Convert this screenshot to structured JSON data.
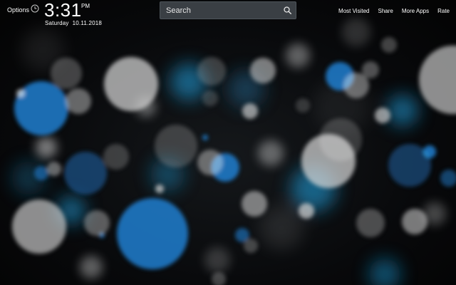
{
  "header": {
    "options_label": "Options",
    "clock_icon": "clock-icon",
    "time": "3:31",
    "ampm": "PM",
    "day": "Saturday",
    "date": "10.11.2018"
  },
  "search": {
    "placeholder": "Search",
    "icon": "search-icon"
  },
  "nav": {
    "most_visited": "Most Visited",
    "share": "Share",
    "more_apps": "More Apps",
    "rate": "Rate"
  },
  "wallpaper": {
    "theme": "blue and grey bokeh circles on black",
    "colors": {
      "background": "#050607",
      "blue": "#1e7fd0",
      "cyan": "#1aa6e6",
      "grey": "#d6d6d6"
    }
  }
}
